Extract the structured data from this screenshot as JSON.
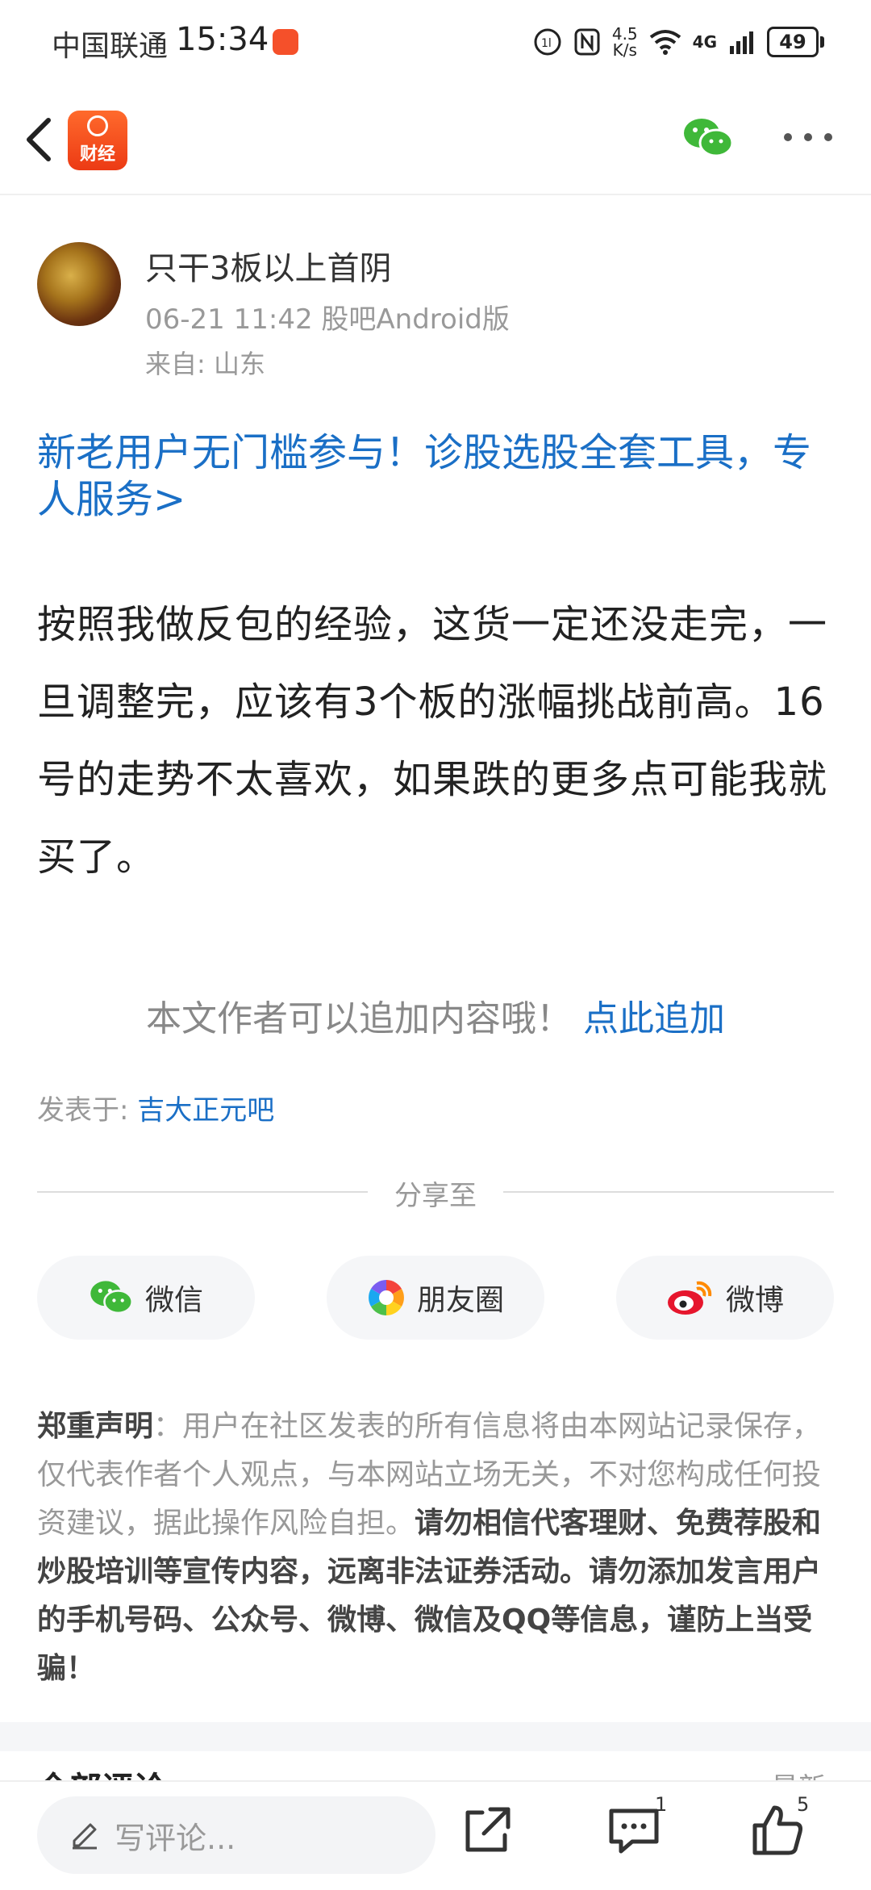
{
  "status_bar": {
    "carrier": "中国联通",
    "time": "15:34",
    "net_speed_value": "4.5",
    "net_speed_unit": "K/s",
    "network": "4G",
    "battery": "49"
  },
  "nav": {
    "app_name": "财经"
  },
  "post": {
    "author": "只干3板以上首阴",
    "meta": "06-21 11:42 股吧Android版",
    "location": "来自: 山东",
    "promo": "新老用户无门槛参与！诊股选股全套工具，专人服务>",
    "body": "按照我做反包的经验，这货一定还没走完，一旦调整完，应该有3个板的涨幅挑战前高。16号的走势不太喜欢，如果跌的更多点可能我就买了。",
    "append_hint": "本文作者可以追加内容哦！",
    "append_link": "点此追加",
    "posted_in_label": "发表于:",
    "posted_in_bar": "吉大正元吧"
  },
  "share": {
    "label": "分享至",
    "wechat": "微信",
    "moments": "朋友圈",
    "weibo": "微博"
  },
  "disclaimer": {
    "title": "郑重声明",
    "text": "：用户在社区发表的所有信息将由本网站记录保存，仅代表作者个人观点，与本网站立场无关，不对您构成任何投资建议，据此操作风险自担。",
    "bold_text": "请勿相信代客理财、免费荐股和炒股培训等宣传内容，远离非法证券活动。请勿添加发言用户的手机号码、公众号、微博、微信及QQ等信息，谨防上当受骗！"
  },
  "comments_header": {
    "title": "全部评论",
    "sort": "最新"
  },
  "bottom_bar": {
    "comment_placeholder": "写评论...",
    "comment_count": "1",
    "like_count": "5"
  },
  "colors": {
    "link": "#1a6fc6",
    "brand": "#f5502a",
    "wechat_green": "#3fb839"
  }
}
